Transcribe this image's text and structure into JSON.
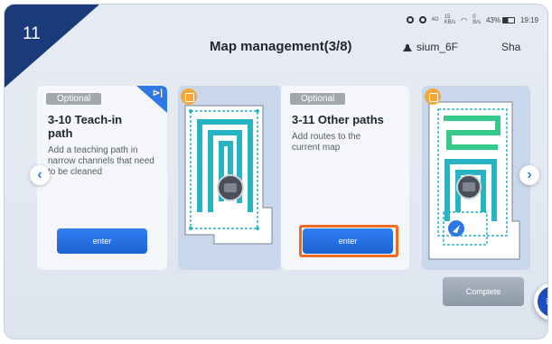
{
  "step_badge": "11",
  "status_bar": {
    "signal_mini_1": "4G",
    "data_rate_1": "15",
    "data_rate_unit_1": "KB/s",
    "data_rate_2": "0",
    "data_rate_unit_2": "B/s",
    "battery": "43%",
    "time": "19:19"
  },
  "header": {
    "title": "Map management(3/8)",
    "site_name": "sium_6F",
    "share_label": "Sha"
  },
  "cards": [
    {
      "tag": "Optional",
      "title": "3-10  Teach-in path",
      "description": "Add a teaching path in narrow channels that need to be cleaned",
      "button": "enter",
      "flag": "⊳|"
    },
    {
      "tag": "Optional",
      "title": "3-11  Other paths",
      "description": "Add routes to the current map",
      "button": "enter"
    }
  ],
  "footer": {
    "complete_label": "Complete",
    "fab_glyph": "≡"
  },
  "colors": {
    "accent": "#2e78e6",
    "highlight": "#f06a22",
    "badge": "#1b3a7a",
    "path_teal": "#29b4c4",
    "path_green": "#36c98c"
  }
}
